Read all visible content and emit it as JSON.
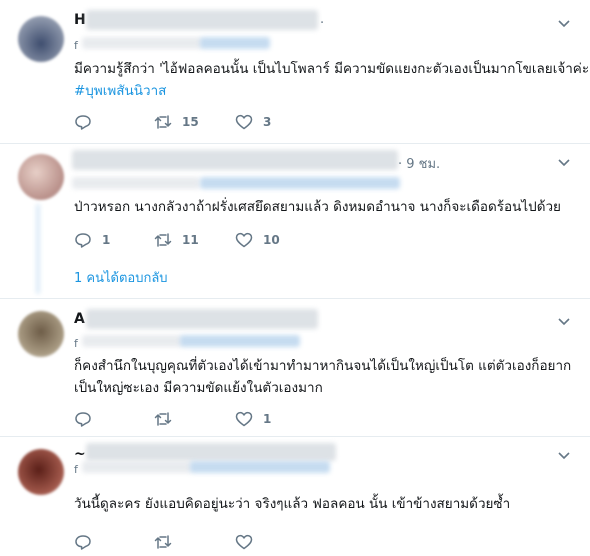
{
  "tweets": [
    {
      "name_initial": "H",
      "time": ".",
      "handle_initial": "f",
      "text_line1": "มีความรู้สึกว่า 'ไอ้ฟอลคอนนั้น เป็นไบโพลาร์ มีความขัดแยงกะตัวเองเป็นมากโขเลยเจ้าค่ะ",
      "hashtag": "#บุพเพสันนิวาส",
      "reply_count": "",
      "retweet_count": "15",
      "like_count": "3",
      "avatar_color": "#5a6a86"
    },
    {
      "name_initial": "",
      "time": "· 9 ชม.",
      "handle_initial": "",
      "text_line1": "ป่าวหรอก นางกลัวงาถ้าฝรั่งเศสยึดสยามแล้ว ดิงหมดอำนาจ นางก็จะเดือดร้อนไปด้วย",
      "reply_count": "1",
      "retweet_count": "11",
      "like_count": "10",
      "replies_link": "1 คนได้ตอบกลับ",
      "avatar_color": "#c9a9a3"
    },
    {
      "name_initial": "A",
      "time": "",
      "handle_initial": "f",
      "text_line1": "ก็คงสำนึกในบุญคุณที่ตัวเองได้เข้ามาทำมาหากินจนได้เป็นใหญ่เป็นโต แต่ตัวเองก็อยาก",
      "text_line2": "เป็นใหญ่ซะเอง มีความขัดแย้งในตัวเองมาก",
      "reply_count": "",
      "retweet_count": "",
      "like_count": "1",
      "avatar_color": "#8a7a62"
    },
    {
      "name_initial": "~",
      "time": "",
      "handle_initial": "f",
      "text_line1": "วันนี้ดูละคร ยังแอบคิดอยู่นะว่า จริงๆแล้ว ฟอลคอน นั้น เข้าข้างสยามด้วยซ้ำ",
      "avatar_color": "#8a3a2e"
    }
  ],
  "icons": {
    "reply": "reply-icon",
    "retweet": "retweet-icon",
    "like": "like-icon",
    "menu": "chevron-down-icon"
  },
  "colors": {
    "link": "#1b95e0",
    "muted": "#657786",
    "divider": "#e6ecf0"
  }
}
